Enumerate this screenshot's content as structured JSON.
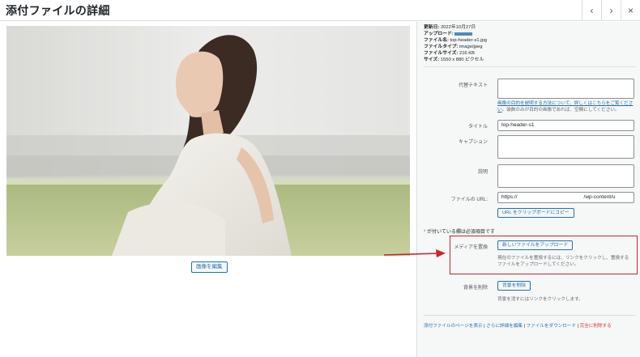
{
  "header": {
    "title": "添付ファイルの詳細",
    "prev_icon": "‹",
    "next_icon": "›",
    "close_icon": "×"
  },
  "preview": {
    "edit_image_label": "画像を編集"
  },
  "details": {
    "uploaded_on_label": "更新日:",
    "uploaded_on": "2022年10月27日",
    "uploaded_by_label": "アップロード:",
    "filename_label": "ファイル名:",
    "filename": "top-header-s1.jpg",
    "filetype_label": "ファイルタイプ:",
    "filetype": "image/jpeg",
    "filesize_label": "ファイルサイズ:",
    "filesize": "216 KB",
    "dimensions_label": "サイズ:",
    "dimensions": "1550 x 880 ピクセル"
  },
  "form": {
    "alt_label": "代替テキスト",
    "alt_value": "",
    "alt_help_link": "画像の目的を説明する方法について、詳しくはこちらをご覧ください",
    "alt_help_text": "。装飾のみが目的の画像であれば、空欄にしてください。",
    "title_label": "タイトル",
    "title_value": "top-header-s1",
    "caption_label": "キャプション",
    "caption_value": "",
    "description_label": "説明",
    "description_value": "",
    "url_label": "ファイルの URL:",
    "url_value_start": "https://",
    "url_value_end": "/wp-content/u",
    "copy_url_label": "URL をクリップボードにコピー",
    "required_note": "が付いている欄は必須項目です",
    "required_star": "*"
  },
  "replace": {
    "label": "メディアを置換",
    "button_label": "新しいファイルをアップロード",
    "help": "現在のファイルを置換するには、リンクをクリックし、置換するファイルをアップロードしてください。"
  },
  "background": {
    "label": "背景を削除",
    "button_label": "背景を削除",
    "help": "背景を消すにはリンクをクリックします。"
  },
  "footer": {
    "view_page": "添付ファイルのページを表示",
    "edit_more": "さらに詳細を編集",
    "download": "ファイルをダウンロード",
    "delete": "完全に削除する",
    "separator": " | "
  },
  "colors": {
    "accent": "#2271b1",
    "highlight_border": "#c9242b",
    "danger": "#d63638"
  }
}
